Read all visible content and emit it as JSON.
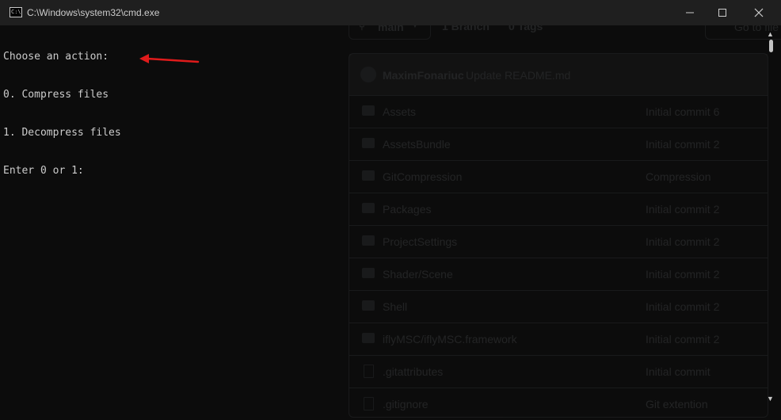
{
  "window": {
    "title": "C:\\Windows\\system32\\cmd.exe",
    "icon": "C:\\",
    "controls": [
      "minimize",
      "maximize",
      "close"
    ]
  },
  "console": {
    "lines": [
      "Choose an action:",
      "0. Compress files",
      "1. Decompress files",
      "Enter 0 or 1:"
    ],
    "text_color": "#cccccc",
    "background": "#0c0c0c"
  },
  "annotation": {
    "type": "arrow",
    "color": "#e01b1b"
  },
  "background_repo": {
    "branch": "main",
    "branches": "1 Branch",
    "tags": "0 Tags",
    "goto": "Go to file",
    "commit": {
      "author": "MaximFonariuc",
      "message": "Update README.md"
    },
    "files": [
      {
        "name": "Assets",
        "commit": "Initial commit 6",
        "type": "folder"
      },
      {
        "name": "AssetsBundle",
        "commit": "Initial commit 2",
        "type": "folder"
      },
      {
        "name": "GitCompression",
        "commit": "Compression",
        "type": "folder"
      },
      {
        "name": "Packages",
        "commit": "Initial commit 2",
        "type": "folder"
      },
      {
        "name": "ProjectSettings",
        "commit": "Initial commit 2",
        "type": "folder"
      },
      {
        "name": "Shader/Scene",
        "commit": "Initial commit 2",
        "type": "folder"
      },
      {
        "name": "Shell",
        "commit": "Initial commit 2",
        "type": "folder"
      },
      {
        "name": "iflyMSC/iflyMSC.framework",
        "commit": "Initial commit 2",
        "type": "folder"
      },
      {
        "name": ".gitattributes",
        "commit": "Initial commit",
        "type": "file"
      },
      {
        "name": ".gitignore",
        "commit": "Git extention",
        "type": "file"
      }
    ]
  }
}
